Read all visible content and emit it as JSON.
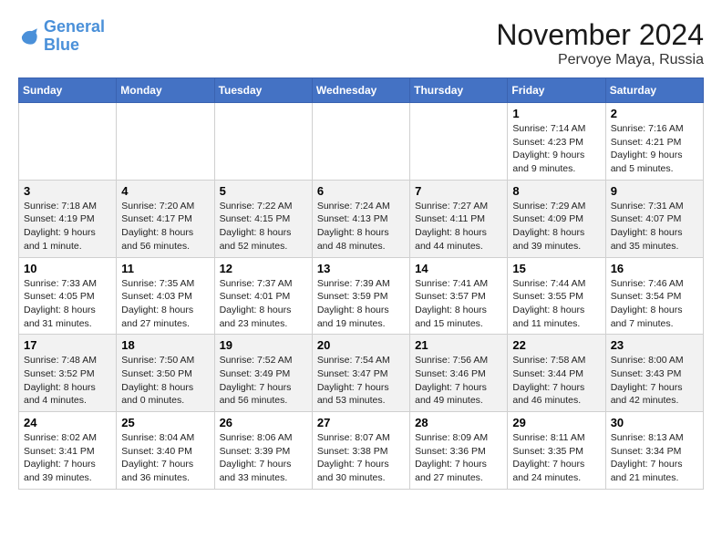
{
  "logo": {
    "line1": "General",
    "line2": "Blue"
  },
  "title": "November 2024",
  "location": "Pervoye Maya, Russia",
  "days_of_week": [
    "Sunday",
    "Monday",
    "Tuesday",
    "Wednesday",
    "Thursday",
    "Friday",
    "Saturday"
  ],
  "weeks": [
    [
      {
        "day": "",
        "info": ""
      },
      {
        "day": "",
        "info": ""
      },
      {
        "day": "",
        "info": ""
      },
      {
        "day": "",
        "info": ""
      },
      {
        "day": "",
        "info": ""
      },
      {
        "day": "1",
        "info": "Sunrise: 7:14 AM\nSunset: 4:23 PM\nDaylight: 9 hours and 9 minutes."
      },
      {
        "day": "2",
        "info": "Sunrise: 7:16 AM\nSunset: 4:21 PM\nDaylight: 9 hours and 5 minutes."
      }
    ],
    [
      {
        "day": "3",
        "info": "Sunrise: 7:18 AM\nSunset: 4:19 PM\nDaylight: 9 hours and 1 minute."
      },
      {
        "day": "4",
        "info": "Sunrise: 7:20 AM\nSunset: 4:17 PM\nDaylight: 8 hours and 56 minutes."
      },
      {
        "day": "5",
        "info": "Sunrise: 7:22 AM\nSunset: 4:15 PM\nDaylight: 8 hours and 52 minutes."
      },
      {
        "day": "6",
        "info": "Sunrise: 7:24 AM\nSunset: 4:13 PM\nDaylight: 8 hours and 48 minutes."
      },
      {
        "day": "7",
        "info": "Sunrise: 7:27 AM\nSunset: 4:11 PM\nDaylight: 8 hours and 44 minutes."
      },
      {
        "day": "8",
        "info": "Sunrise: 7:29 AM\nSunset: 4:09 PM\nDaylight: 8 hours and 39 minutes."
      },
      {
        "day": "9",
        "info": "Sunrise: 7:31 AM\nSunset: 4:07 PM\nDaylight: 8 hours and 35 minutes."
      }
    ],
    [
      {
        "day": "10",
        "info": "Sunrise: 7:33 AM\nSunset: 4:05 PM\nDaylight: 8 hours and 31 minutes."
      },
      {
        "day": "11",
        "info": "Sunrise: 7:35 AM\nSunset: 4:03 PM\nDaylight: 8 hours and 27 minutes."
      },
      {
        "day": "12",
        "info": "Sunrise: 7:37 AM\nSunset: 4:01 PM\nDaylight: 8 hours and 23 minutes."
      },
      {
        "day": "13",
        "info": "Sunrise: 7:39 AM\nSunset: 3:59 PM\nDaylight: 8 hours and 19 minutes."
      },
      {
        "day": "14",
        "info": "Sunrise: 7:41 AM\nSunset: 3:57 PM\nDaylight: 8 hours and 15 minutes."
      },
      {
        "day": "15",
        "info": "Sunrise: 7:44 AM\nSunset: 3:55 PM\nDaylight: 8 hours and 11 minutes."
      },
      {
        "day": "16",
        "info": "Sunrise: 7:46 AM\nSunset: 3:54 PM\nDaylight: 8 hours and 7 minutes."
      }
    ],
    [
      {
        "day": "17",
        "info": "Sunrise: 7:48 AM\nSunset: 3:52 PM\nDaylight: 8 hours and 4 minutes."
      },
      {
        "day": "18",
        "info": "Sunrise: 7:50 AM\nSunset: 3:50 PM\nDaylight: 8 hours and 0 minutes."
      },
      {
        "day": "19",
        "info": "Sunrise: 7:52 AM\nSunset: 3:49 PM\nDaylight: 7 hours and 56 minutes."
      },
      {
        "day": "20",
        "info": "Sunrise: 7:54 AM\nSunset: 3:47 PM\nDaylight: 7 hours and 53 minutes."
      },
      {
        "day": "21",
        "info": "Sunrise: 7:56 AM\nSunset: 3:46 PM\nDaylight: 7 hours and 49 minutes."
      },
      {
        "day": "22",
        "info": "Sunrise: 7:58 AM\nSunset: 3:44 PM\nDaylight: 7 hours and 46 minutes."
      },
      {
        "day": "23",
        "info": "Sunrise: 8:00 AM\nSunset: 3:43 PM\nDaylight: 7 hours and 42 minutes."
      }
    ],
    [
      {
        "day": "24",
        "info": "Sunrise: 8:02 AM\nSunset: 3:41 PM\nDaylight: 7 hours and 39 minutes."
      },
      {
        "day": "25",
        "info": "Sunrise: 8:04 AM\nSunset: 3:40 PM\nDaylight: 7 hours and 36 minutes."
      },
      {
        "day": "26",
        "info": "Sunrise: 8:06 AM\nSunset: 3:39 PM\nDaylight: 7 hours and 33 minutes."
      },
      {
        "day": "27",
        "info": "Sunrise: 8:07 AM\nSunset: 3:38 PM\nDaylight: 7 hours and 30 minutes."
      },
      {
        "day": "28",
        "info": "Sunrise: 8:09 AM\nSunset: 3:36 PM\nDaylight: 7 hours and 27 minutes."
      },
      {
        "day": "29",
        "info": "Sunrise: 8:11 AM\nSunset: 3:35 PM\nDaylight: 7 hours and 24 minutes."
      },
      {
        "day": "30",
        "info": "Sunrise: 8:13 AM\nSunset: 3:34 PM\nDaylight: 7 hours and 21 minutes."
      }
    ]
  ]
}
